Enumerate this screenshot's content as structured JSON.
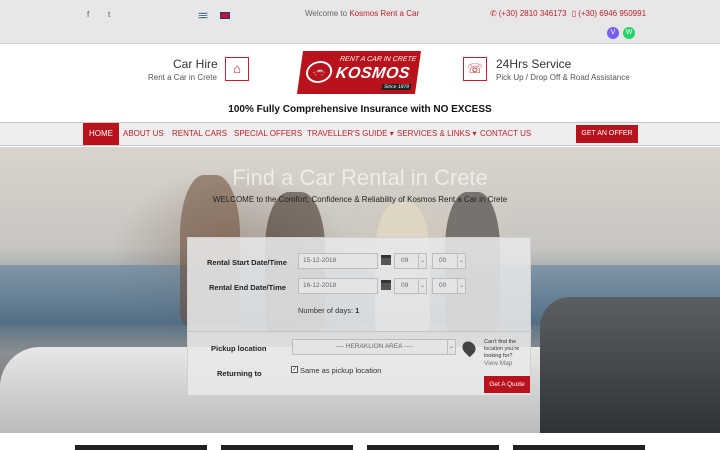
{
  "topbar": {
    "social": [
      "f",
      "t"
    ],
    "welcome_prefix": "Welcome to ",
    "welcome_brand": "Kosmos Rent a Car",
    "phone1": "(+30) 2810 346173",
    "phone2": "(+30) 6946 950991",
    "phone_icon": "phone-icon",
    "mobile_icon": "mobile-icon",
    "viber_glyph": "V",
    "whatsapp_glyph": "W"
  },
  "header": {
    "carhire_title": "Car Hire",
    "carhire_sub": "Rent a Car in Crete",
    "home_glyph": "⌂",
    "logo_top": "RENT A CAR IN CRETE",
    "logo_main": "KOSMOS",
    "logo_since": "Since 1979",
    "service_title": "24Hrs Service",
    "service_sub": "Pick Up / Drop Off & Road Assistance",
    "service_glyph": "☏",
    "insurance": "100% Fully Comprehensive Insurance with NO EXCESS"
  },
  "nav": {
    "items": [
      "HOME",
      "ABOUT US",
      "RENTAL CARS",
      "SPECIAL OFFERS",
      "TRAVELLER'S GUIDE ▾",
      "SERVICES & LINKS ▾",
      "CONTACT US"
    ],
    "offer_button": "GET AN OFFER"
  },
  "hero": {
    "title": "Find a Car Rental in Crete",
    "subtitle": "WELCOME to the Comfort, Confidence & Reliability of Kosmos Rent a Car in Crete"
  },
  "form": {
    "start_label": "Rental Start Date/Time",
    "start_date": "15-12-2018",
    "start_hour": "09",
    "start_min": "00",
    "end_label": "Rental End Date/Time",
    "end_date": "16-12-2018",
    "end_hour": "09",
    "end_min": "00",
    "days_label": "Number of days: ",
    "days_value": "1",
    "pickup_label": "Pickup location",
    "pickup_value": "---- HERAKLION AREA ----",
    "cant_find": "Can't find the location you're looking for?",
    "view_map": "View Map",
    "returning_label": "Returning to",
    "same_as_pickup": "Same as pickup location",
    "checkbox_checked": true,
    "quote_button": "Get A Quote",
    "select_arrow": "⌄"
  },
  "colors": {
    "brand_red": "#b8121d",
    "topbar_bg": "#e7e7e7",
    "nav_bg": "#eeeeee"
  }
}
